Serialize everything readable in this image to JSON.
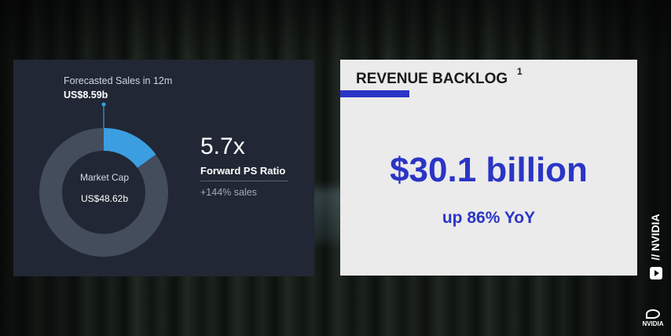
{
  "chart_data": {
    "type": "pie",
    "donut": true,
    "slices": [
      {
        "label": "Forecasted Sales in 12m",
        "value": 8.59,
        "display": "US$8.59b",
        "color": "#3b9ee0"
      },
      {
        "label": "Market Cap",
        "value": 48.62,
        "display": "US$48.62b",
        "color": "#444d5c"
      }
    ],
    "annotation": {
      "label": "Forecasted Sales in 12m",
      "value": "US$8.59b"
    },
    "center": {
      "label": "Market Cap",
      "value": "US$48.62b"
    }
  },
  "metrics": {
    "ps_value": "5.7x",
    "ps_label": "Forward PS Ratio",
    "ps_sub": "+144% sales"
  },
  "backlog": {
    "title": "REVENUE BACKLOG",
    "footnote": "1",
    "amount": "$30.1 billion",
    "growth": "up 86% YoY",
    "accent": "#2b35c6"
  },
  "branding": {
    "vertical": "// NVIDIA",
    "logo": "NVIDIA",
    "icon": "youtube-play-icon"
  }
}
